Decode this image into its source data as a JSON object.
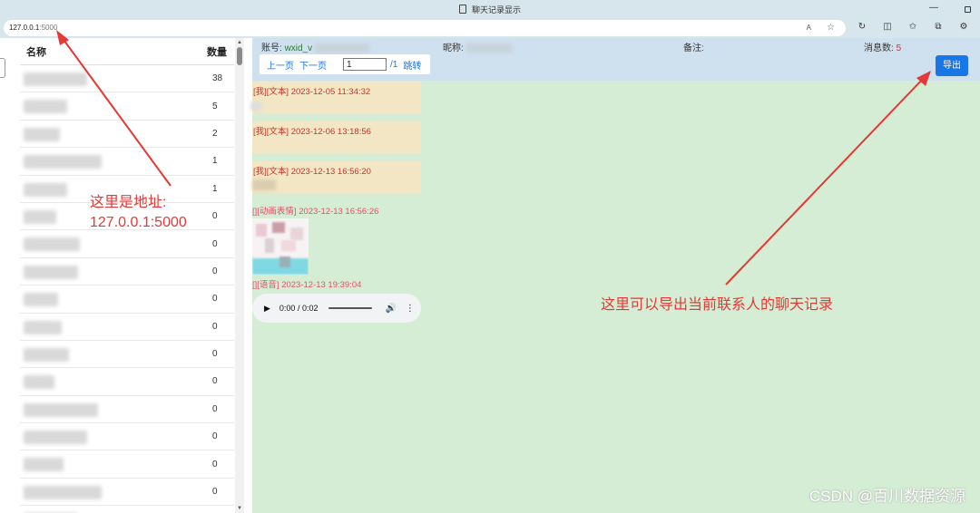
{
  "window": {
    "title": "聊天记录显示"
  },
  "browser": {
    "url_host": "127.0.0.1",
    "url_port": ":5000",
    "reader_icon": "A",
    "star_icon": "☆"
  },
  "contacts": {
    "header_name": "名称",
    "header_count": "数量",
    "rows": [
      {
        "count": "38",
        "w": 70
      },
      {
        "count": "5",
        "w": 48
      },
      {
        "count": "2",
        "w": 40
      },
      {
        "count": "1",
        "w": 86
      },
      {
        "count": "1",
        "w": 48
      },
      {
        "count": "0",
        "w": 36
      },
      {
        "count": "0",
        "w": 62
      },
      {
        "count": "0",
        "w": 60
      },
      {
        "count": "0",
        "w": 38
      },
      {
        "count": "0",
        "w": 42
      },
      {
        "count": "0",
        "w": 50
      },
      {
        "count": "0",
        "w": 34
      },
      {
        "count": "0",
        "w": 82
      },
      {
        "count": "0",
        "w": 70
      },
      {
        "count": "0",
        "w": 44
      },
      {
        "count": "0",
        "w": 86
      },
      {
        "count": "0",
        "w": 60
      }
    ]
  },
  "chat_header": {
    "account_label": "账号:",
    "account_value": "wxid_v",
    "nickname_label": "昵称:",
    "remark_label": "备注:",
    "message_count_label": "消息数:",
    "message_count": "5"
  },
  "pager": {
    "prev": "上一页",
    "next": "下一页",
    "page_value": "1",
    "total": "/1",
    "jump": "跳转"
  },
  "export_button": "导出",
  "messages": [
    {
      "label": "[我][文本] 2023-12-05 11:34:32"
    },
    {
      "label": "[我][文本] 2023-12-06 13:18:56"
    },
    {
      "label": "[我][文本] 2023-12-13 16:56:20"
    },
    {
      "label": "[][动画表情] 2023-12-13 16:56:26"
    },
    {
      "label": "[][语音] 2023-12-13 19:39:04"
    }
  ],
  "audio": {
    "time": "0:00 / 0:02"
  },
  "annotations": {
    "address_note_line1": "这里是地址:",
    "address_note_line2": "127.0.0.1:5000",
    "export_note": "这里可以导出当前联系人的聊天记录"
  },
  "watermark": "CSDN @百川数据资源",
  "colors": {
    "accent": "#1976e6",
    "annotation": "#e53935",
    "chat_bg": "#d4edd4",
    "bubble": "#f2e6c4"
  }
}
